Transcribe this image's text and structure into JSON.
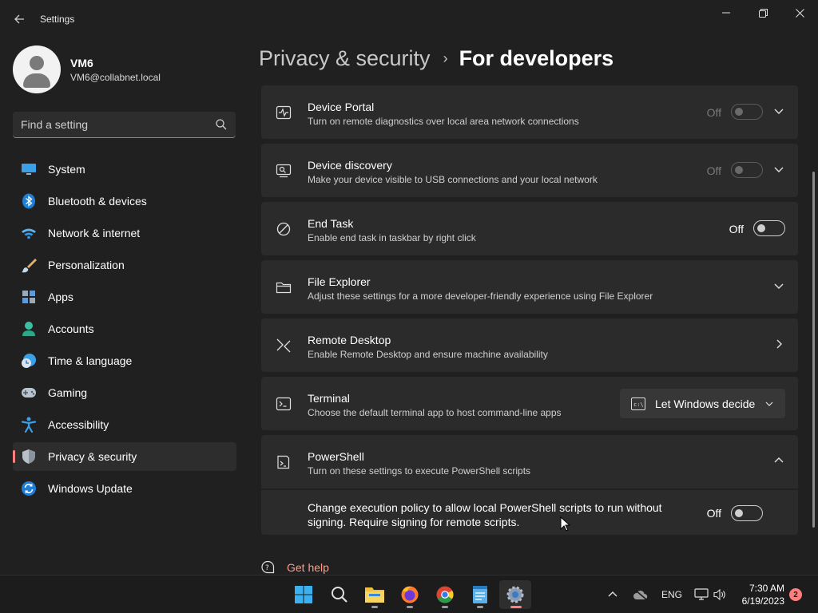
{
  "window": {
    "title": "Settings"
  },
  "profile": {
    "name": "VM6",
    "email": "VM6@collabnet.local"
  },
  "search": {
    "placeholder": "Find a setting"
  },
  "sidebar": {
    "items": [
      {
        "label": "System",
        "icon": "monitor-icon"
      },
      {
        "label": "Bluetooth & devices",
        "icon": "bluetooth-icon"
      },
      {
        "label": "Network & internet",
        "icon": "wifi-icon"
      },
      {
        "label": "Personalization",
        "icon": "brush-icon"
      },
      {
        "label": "Apps",
        "icon": "apps-icon"
      },
      {
        "label": "Accounts",
        "icon": "person-icon"
      },
      {
        "label": "Time & language",
        "icon": "clock-globe-icon"
      },
      {
        "label": "Gaming",
        "icon": "gamepad-icon"
      },
      {
        "label": "Accessibility",
        "icon": "accessibility-icon"
      },
      {
        "label": "Privacy & security",
        "icon": "shield-icon",
        "selected": true
      },
      {
        "label": "Windows Update",
        "icon": "update-icon"
      }
    ]
  },
  "breadcrumb": {
    "parent": "Privacy & security",
    "separator": "›",
    "current": "For developers"
  },
  "settings": [
    {
      "title": "Device Portal",
      "desc": "Turn on remote diagnostics over local area network connections",
      "state": "Off",
      "enabled": false,
      "icon": "pulse-icon",
      "control": "toggle+expand"
    },
    {
      "title": "Device discovery",
      "desc": "Make your device visible to USB connections and your local network",
      "state": "Off",
      "enabled": false,
      "icon": "device-search-icon",
      "control": "toggle+expand"
    },
    {
      "title": "End Task",
      "desc": "Enable end task in taskbar by right click",
      "state": "Off",
      "enabled": true,
      "icon": "prohibited-icon",
      "control": "toggle"
    },
    {
      "title": "File Explorer",
      "desc": "Adjust these settings for a more developer-friendly experience using File Explorer",
      "icon": "folder-icon",
      "control": "expand"
    },
    {
      "title": "Remote Desktop",
      "desc": "Enable Remote Desktop and ensure machine availability",
      "icon": "remote-desktop-icon",
      "control": "navigate"
    },
    {
      "title": "Terminal",
      "desc": "Choose the default terminal app to host command-line apps",
      "icon": "terminal-icon",
      "control": "dropdown",
      "dropdown_value": "Let Windows decide"
    },
    {
      "title": "PowerShell",
      "desc": "Turn on these settings to execute PowerShell scripts",
      "icon": "powershell-icon",
      "control": "collapse"
    }
  ],
  "powershell_option": {
    "text": "Change execution policy to allow local PowerShell scripts to run without signing. Require signing for remote scripts.",
    "state": "Off"
  },
  "help": {
    "label": "Get help"
  },
  "taskbar": {
    "apps": [
      "start-icon",
      "search-icon",
      "file-explorer-icon",
      "firefox-icon",
      "chrome-icon",
      "notepad-icon",
      "settings-icon"
    ],
    "language": "ENG",
    "time": "7:30 AM",
    "date": "6/19/2023",
    "notifications": "2"
  },
  "colors": {
    "accent": "#ff7e7e",
    "link": "#ff9d8a",
    "background": "#202020",
    "card": "#2b2b2b"
  }
}
